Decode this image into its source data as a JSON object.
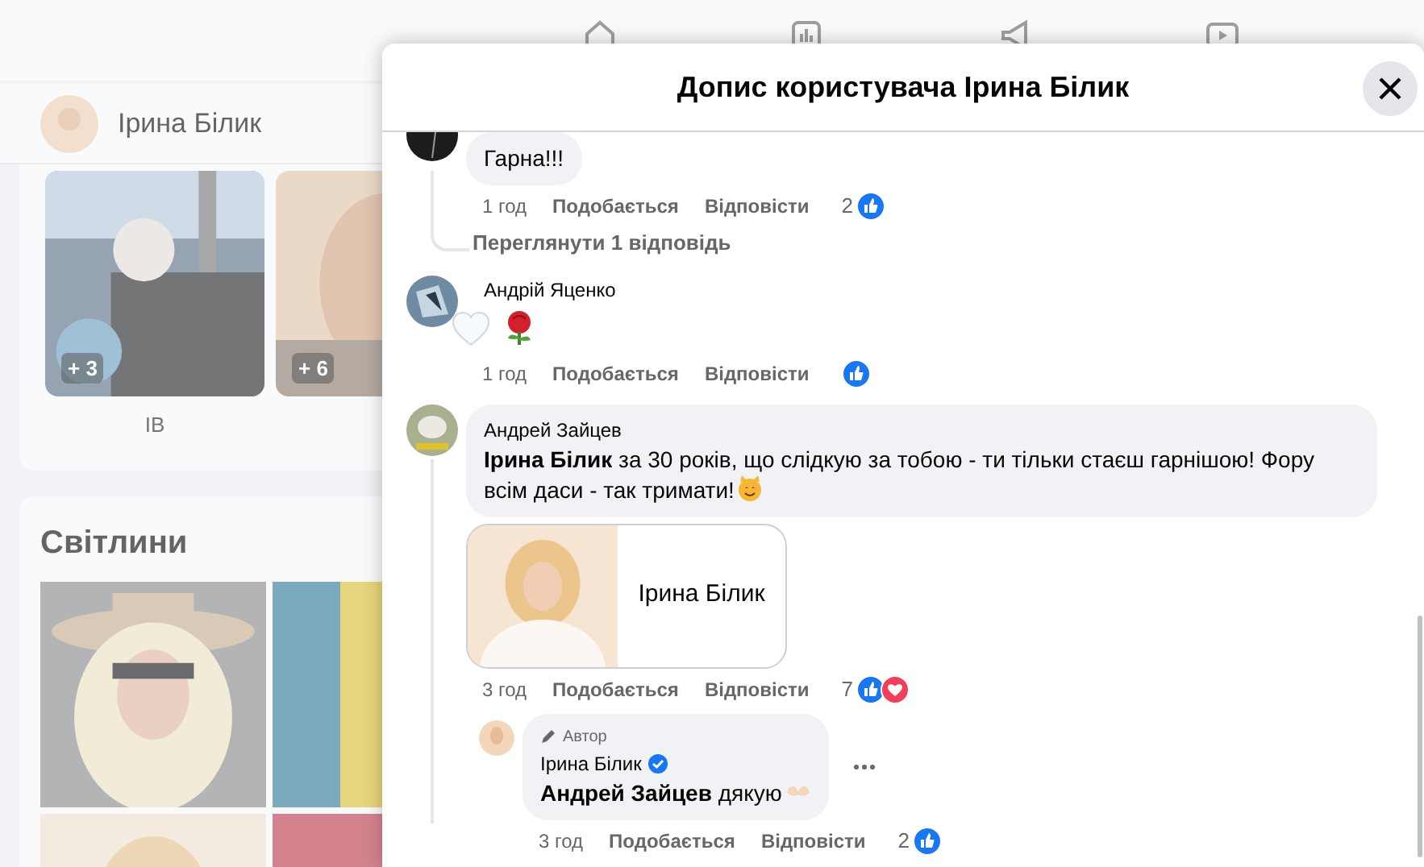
{
  "background": {
    "nav_icons": [
      {
        "kind": "home"
      },
      {
        "kind": "chart"
      },
      {
        "kind": "megaphone"
      },
      {
        "kind": "play"
      }
    ],
    "profile": {
      "name": "Ірина Білик"
    },
    "albums": [
      {
        "kind": "picture",
        "count": "+ 3",
        "label": "IB"
      },
      {
        "kind": "picture",
        "count": "+ 6"
      }
    ],
    "photos_section": {
      "title": "Світлини"
    }
  },
  "dialog": {
    "title": "Допис користувача Ірина Білик",
    "comments": [
      {
        "text": "Гарна!!!",
        "time": "1 год",
        "like": "Подобається",
        "reply": "Відповісти",
        "reaction_count": "2",
        "reactions": [
          {
            "kind": "like"
          }
        ],
        "view_replies": "Переглянути 1 відповідь"
      },
      {
        "author": "Андрій Яценко",
        "stickers": [
          {
            "kind": "heart"
          },
          {
            "kind": "rose"
          }
        ],
        "time": "1 год",
        "like": "Подобається",
        "reply": "Відповісти",
        "reactions": [
          {
            "kind": "like"
          }
        ]
      },
      {
        "author": "Андрей Зайцев",
        "text": "**Ірина Білик** за 30 років, що слідкую за тобою - ти тільки стаєш гарнішою! Фору всім даси - так тримати!",
        "end_sticker": {
          "kind": "cat"
        },
        "link_card": {
          "title": "Ірина Білик"
        },
        "time": "3 год",
        "like": "Подобається",
        "reply": "Відповісти",
        "reaction_count": "7",
        "reactions": [
          {
            "kind": "like"
          },
          {
            "kind": "love"
          }
        ],
        "replies": [
          {
            "badge": "Автор",
            "author": "Ірина Білик",
            "verified": true,
            "text": "**Андрей Зайцев** дякую",
            "end_sticker": {
              "kind": "hands"
            },
            "time": "3 год",
            "like": "Подобається",
            "reply": "Відповісти",
            "reaction_count": "2",
            "reactions": [
              {
                "kind": "like"
              }
            ]
          }
        ]
      }
    ]
  }
}
